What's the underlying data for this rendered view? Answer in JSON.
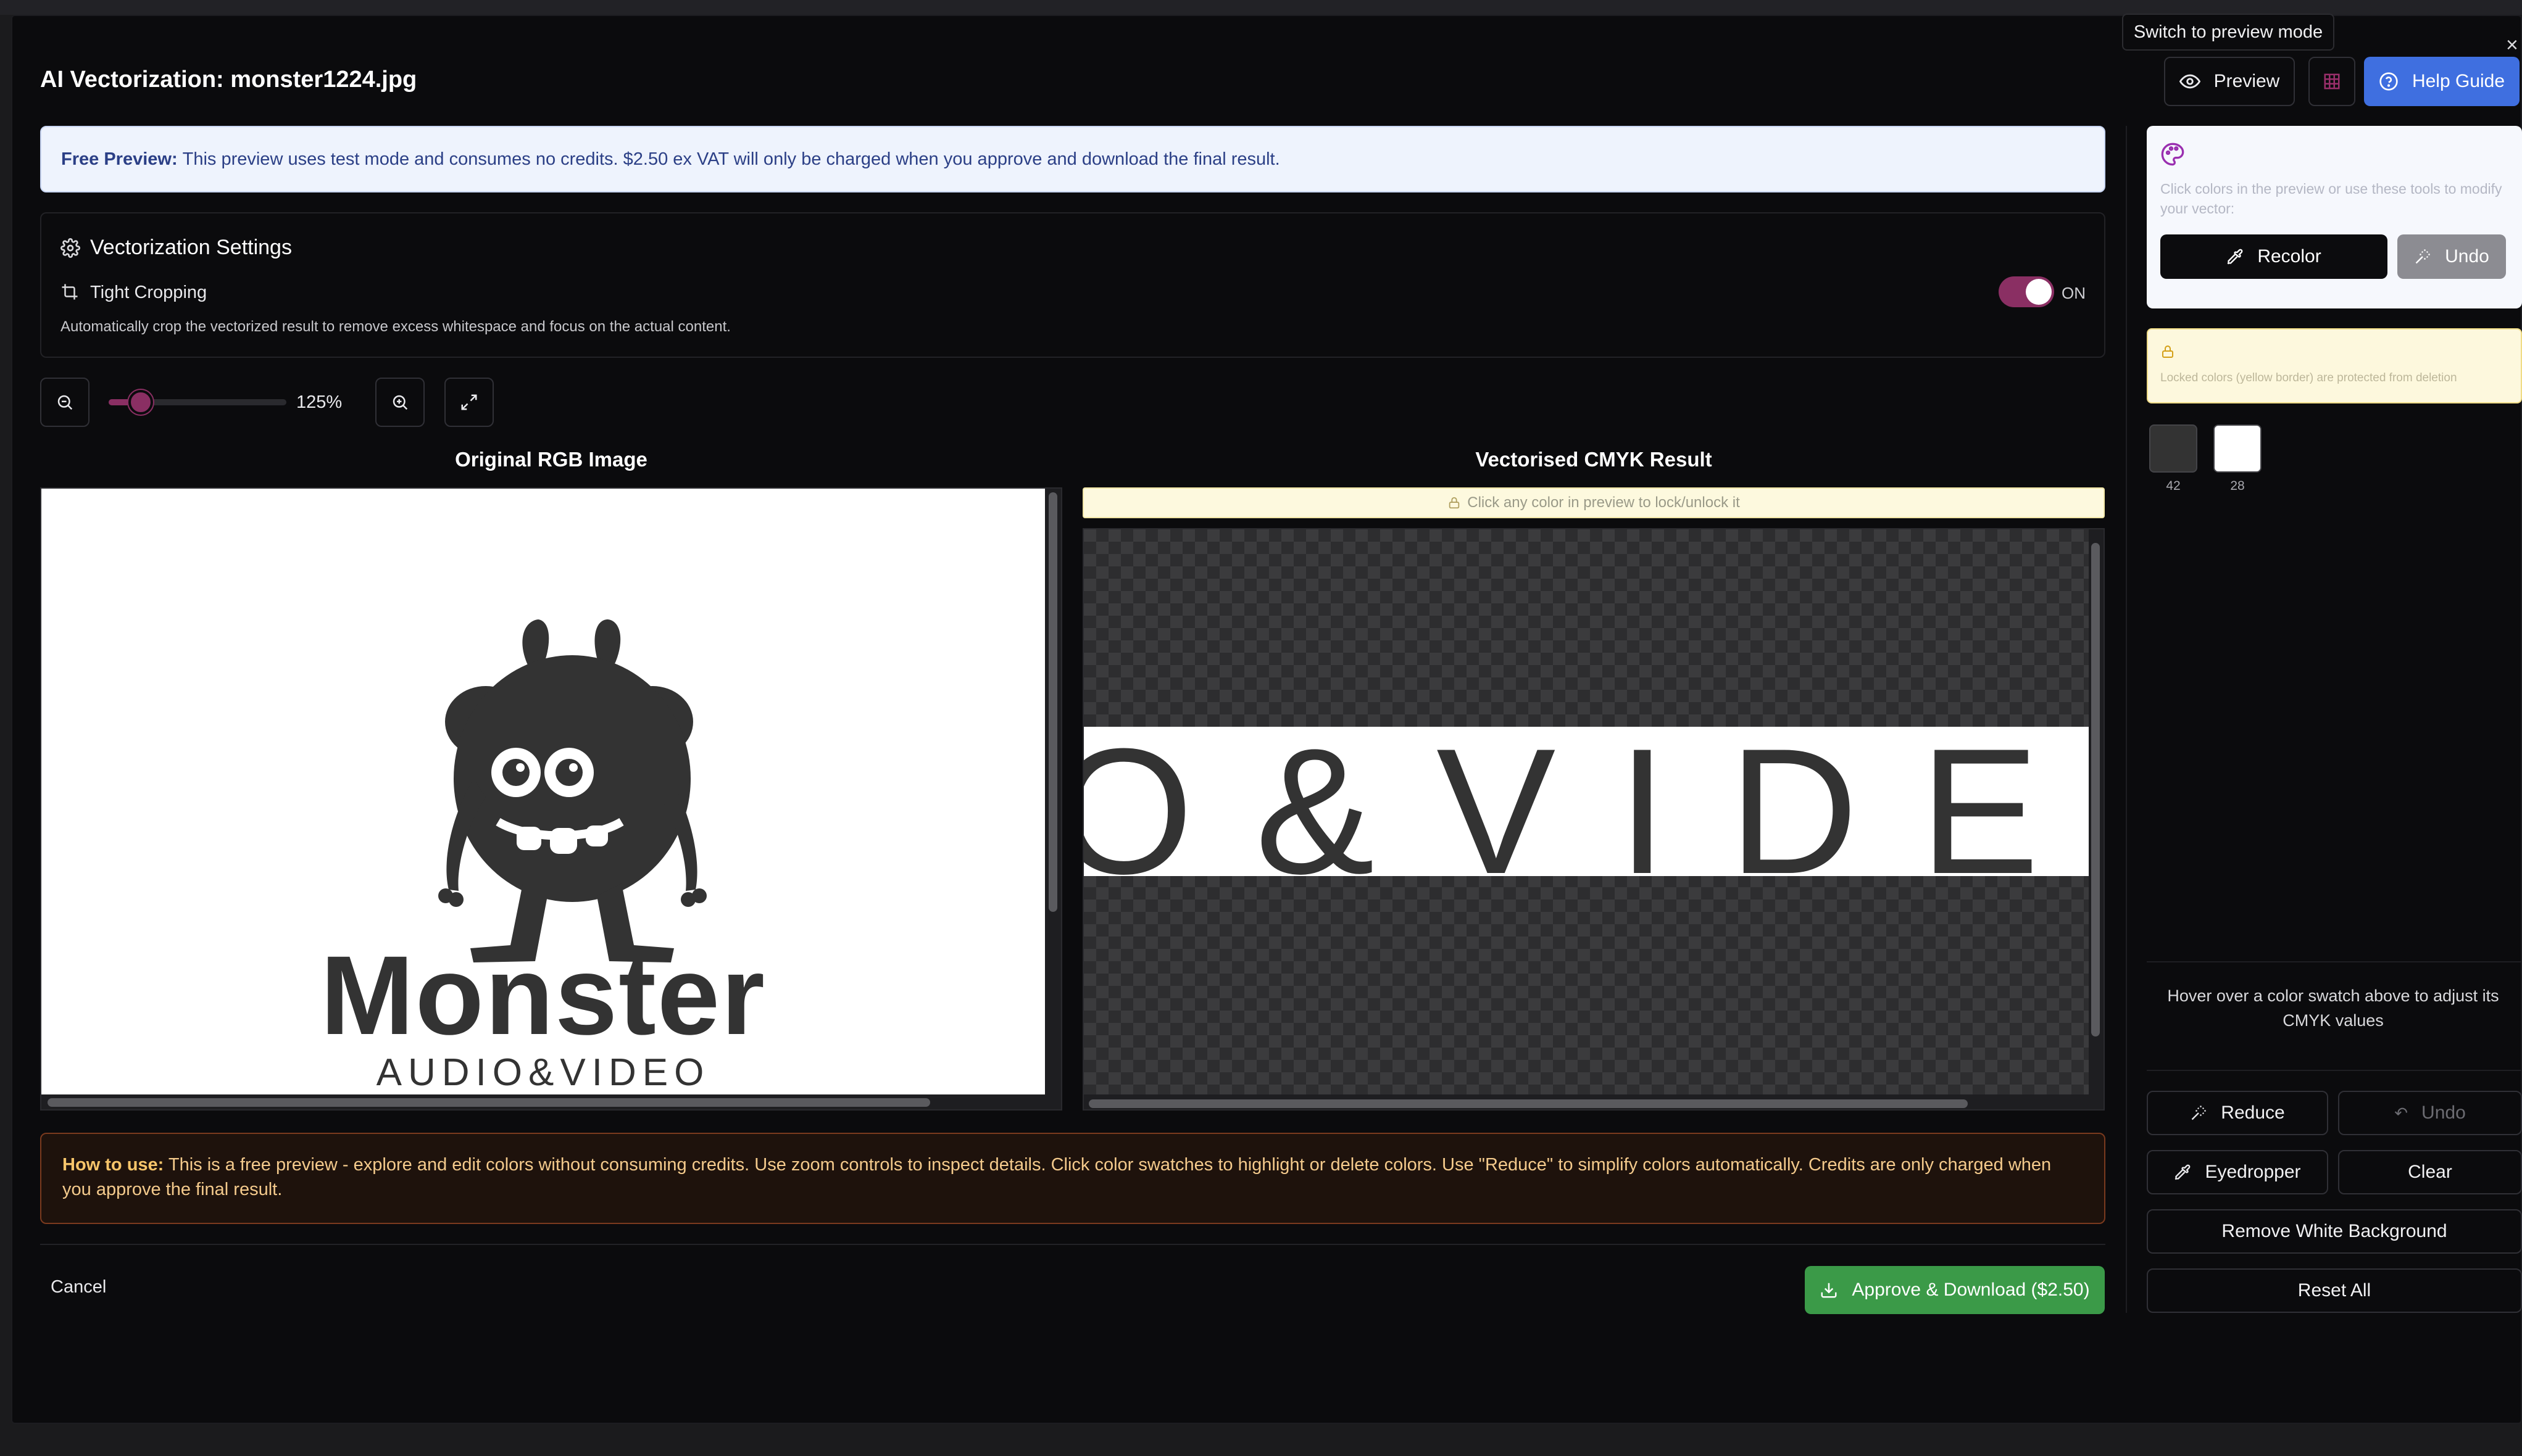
{
  "modal": {
    "title": "AI Vectorization: monster1224.jpg",
    "tooltip": "Switch to preview mode",
    "preview_label": "Preview",
    "help_label": "Help Guide"
  },
  "notice": {
    "bold": "Free Preview:",
    "text": "This preview uses test mode and consumes no credits. $2.50 ex VAT will only be charged when you approve and download the final result."
  },
  "settings": {
    "title": "Vectorization Settings",
    "option_label": "Tight Cropping",
    "option_state": "ON",
    "option_enabled": true,
    "description": "Automatically crop the vectorized result to remove excess whitespace and focus on the actual content."
  },
  "zoom": {
    "value_label": "125%",
    "level_percent": 125
  },
  "panels": {
    "original_title": "Original RGB Image",
    "result_title": "Vectorised CMYK Result",
    "lock_hint": "Click any color in preview to lock/unlock it"
  },
  "artwork": {
    "main_word": "Monster",
    "sub_word": "AUDIO&VIDEO",
    "zoomed_text": "O&VIDEO",
    "ink_color": "#333333"
  },
  "howto": {
    "bold": "How to use:",
    "text": "This is a free preview - explore and edit colors without consuming credits. Use zoom controls to inspect details. Click color swatches to highlight or delete colors. Use \"Reduce\" to simplify colors automatically. Credits are only charged when you approve the final result."
  },
  "footer": {
    "cancel_label": "Cancel",
    "approve_label": "Approve & Download ($2.50)"
  },
  "sidebar": {
    "tools_hint": "Click colors in the preview or use these tools to modify your vector:",
    "recolor_label": "Recolor",
    "undo_label": "Undo",
    "locked_hint": "Locked colors (yellow border) are protected from deletion",
    "swatches": [
      {
        "color": "#333333",
        "label": "42"
      },
      {
        "color": "#ffffff",
        "label": "28"
      }
    ],
    "hover_hint": "Hover over a color swatch above to adjust its CMYK values",
    "reduce_label": "Reduce",
    "undo2_label": "Undo",
    "eyedropper_label": "Eyedropper",
    "clear_label": "Clear",
    "remove_white_label": "Remove White Background",
    "reset_label": "Reset All"
  },
  "colors": {
    "accent_pink": "#8a2f63",
    "help_blue": "#3f6fe0",
    "approve_green": "#3b9a48",
    "notice_bg": "#eef3fd",
    "howto_border": "#7a3a1e"
  }
}
